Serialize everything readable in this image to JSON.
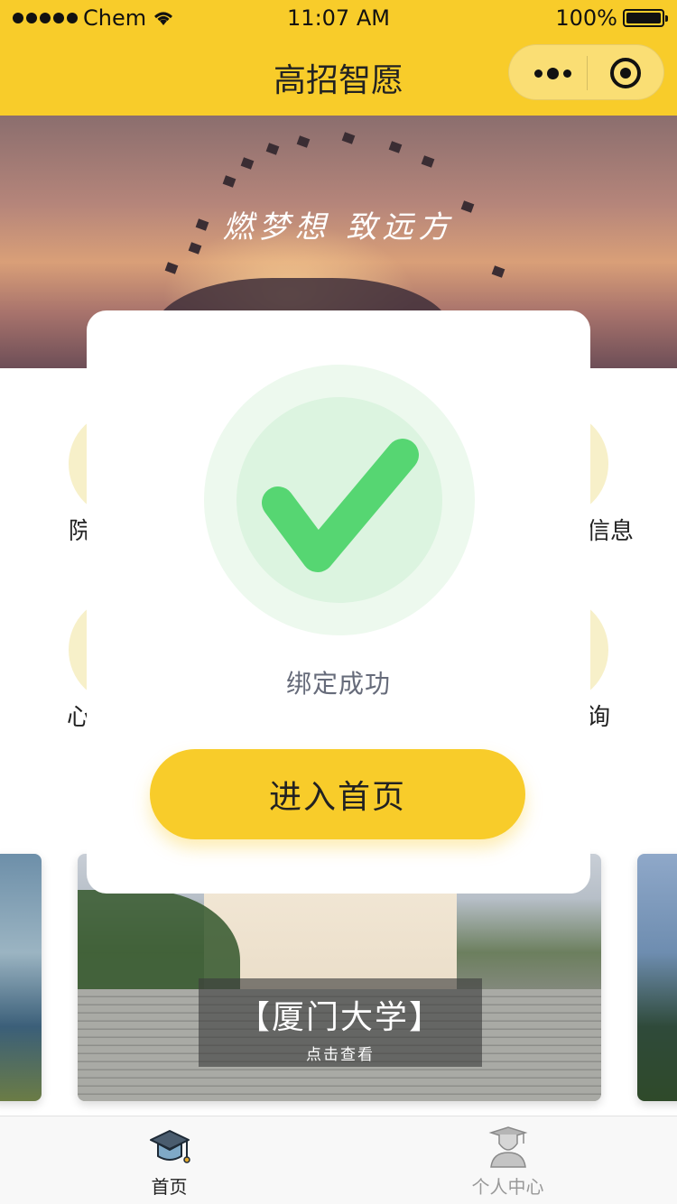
{
  "status_bar": {
    "carrier": "Chem",
    "time": "11:07 AM",
    "battery": "100%"
  },
  "nav": {
    "title": "高招智愿",
    "more_icon": "more-dots-icon",
    "close_icon": "target-circle-icon"
  },
  "banner": {
    "slogan": "燃梦想 致远方"
  },
  "menu": {
    "items": [
      {
        "label": "院"
      },
      {
        "label": "信息"
      },
      {
        "label": "心"
      },
      {
        "label": "询"
      }
    ]
  },
  "modal": {
    "icon": "check-icon",
    "message": "绑定成功",
    "button_label": "进入首页"
  },
  "carousel": {
    "current": {
      "name": "【厦门大学】",
      "hint": "点击查看"
    }
  },
  "tabbar": {
    "tabs": [
      {
        "label": "首页",
        "icon": "graduation-cap-icon",
        "active": true
      },
      {
        "label": "个人中心",
        "icon": "graduate-person-icon",
        "active": false
      }
    ]
  },
  "colors": {
    "brand": "#f8cc2a",
    "success": "#56d672",
    "success_light": "#dcf4e0"
  }
}
